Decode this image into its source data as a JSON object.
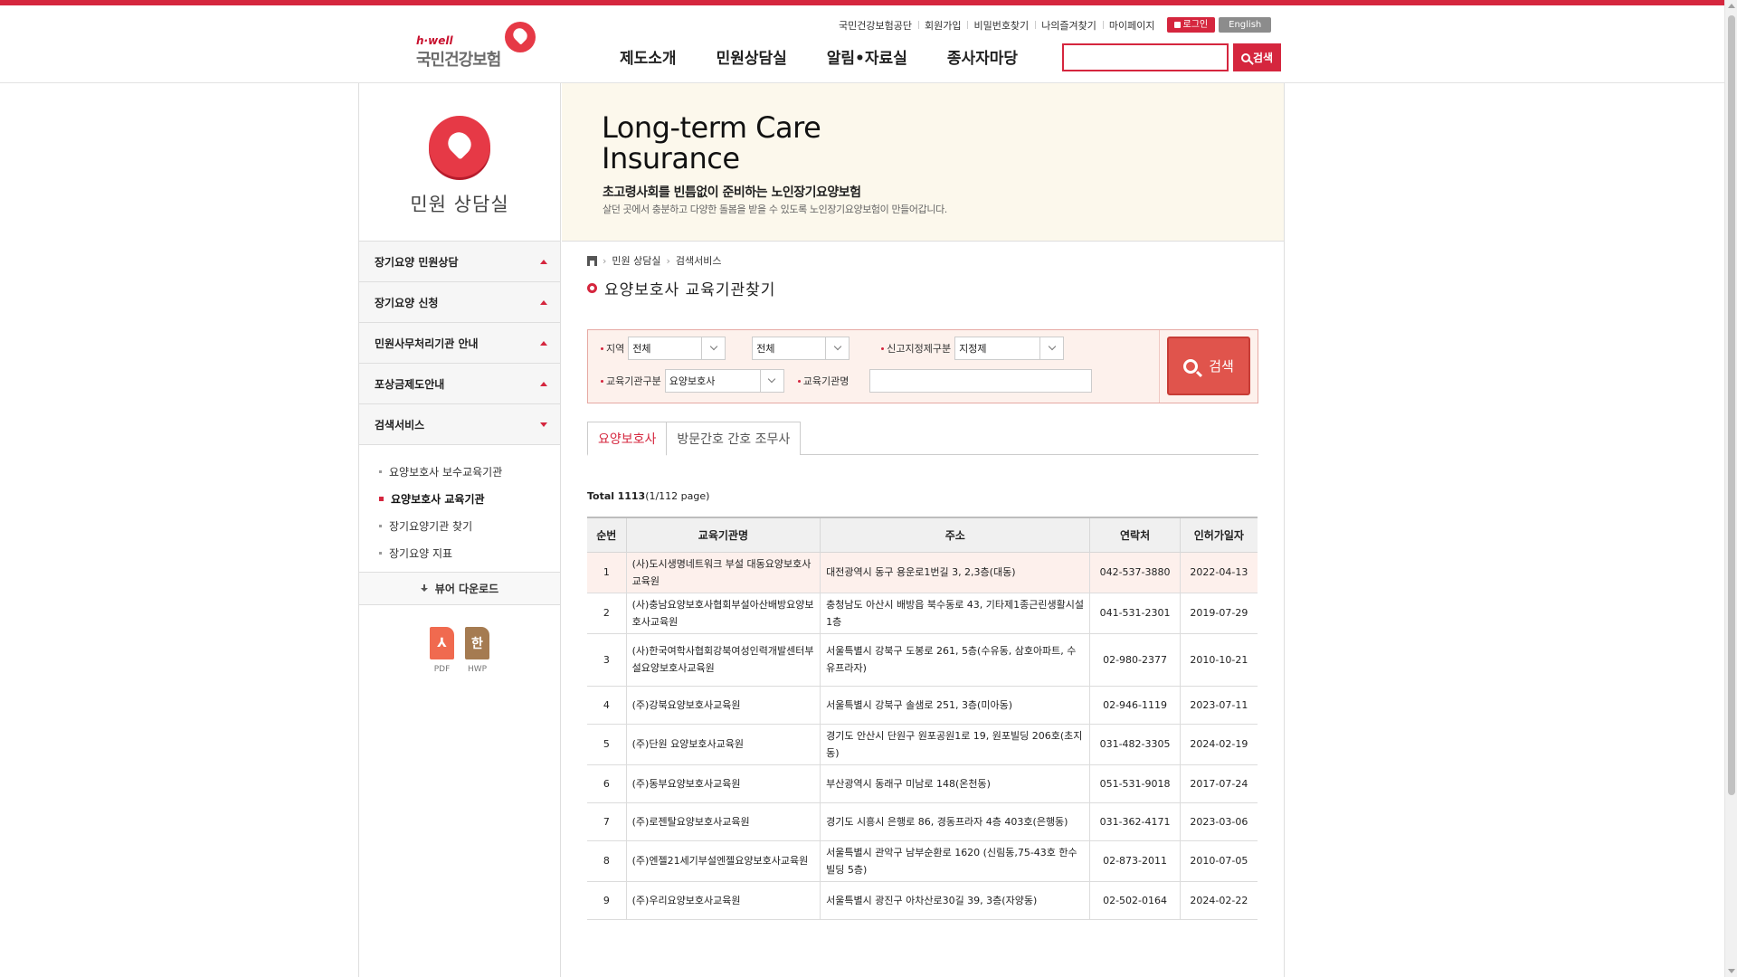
{
  "header": {
    "logo_tagline": "h·well",
    "logo_name": "국민건강보험",
    "util": [
      "국민건강보험공단",
      "회원가입",
      "비밀번호찾기",
      "나의즐겨찾기",
      "마이페이지"
    ],
    "login_label": "로그인",
    "english_label": "English",
    "gnb": [
      "제도소개",
      "민원상담실",
      "알림•자료실",
      "종사자마당"
    ],
    "search_value": "",
    "search_label": "검색"
  },
  "side": {
    "title": "민원 상담실",
    "menu": [
      {
        "label": "장기요양 민원상담"
      },
      {
        "label": "장기요양 신청"
      },
      {
        "label": "민원사무처리기관 안내"
      },
      {
        "label": "포상금제도안내"
      },
      {
        "label": "검색서비스"
      }
    ],
    "submenu": [
      "요양보호사 보수교육기관",
      "요양보호사 교육기관",
      "장기요양기관 찾기",
      "장기요양 지표"
    ],
    "viewer_label": "뷰어 다운로드",
    "files": [
      "PDF",
      "HWP"
    ],
    "hwp_glyph": "한"
  },
  "banner": {
    "en_line1": "Long-term Care",
    "en_line2": "Insurance",
    "ko_main": "초고령사회를 빈틈없이 준비하는 노인장기요양보험",
    "ko_sub": "살던 곳에서 충분하고 다양한 돌봄을 받을 수 있도록 노인장기요양보험이 만들어갑니다."
  },
  "content": {
    "breadcrumb": [
      "민원 상담실",
      "검색서비스"
    ],
    "page_title": "요양보호사 교육기관찾기",
    "filters": {
      "region_label": "지역",
      "region1": "전체",
      "region2": "전체",
      "type_label": "신고지정제구분",
      "type_value": "지정제",
      "category_label": "교육기관구분",
      "category_value": "요양보호사",
      "name_label": "교육기관명",
      "name_value": "",
      "search_label": "검색"
    },
    "tabs": [
      "요양보호사",
      "방문간호 간호 조무사"
    ],
    "total_label": "Total",
    "total_count": "1113",
    "total_page": "(1/112 page)",
    "columns": [
      "순번",
      "교육기관명",
      "주소",
      "연락처",
      "인허가일자"
    ],
    "rows": [
      [
        "1",
        "(사)도시생명네트워크 부설 대동요양보호사교육원",
        "대전광역시 동구 용운로1번길 3, 2,3층(대동)",
        "042-537-3880",
        "2022-04-13"
      ],
      [
        "2",
        "(사)충남요양보호사협회부설아산배방요양보호사교육원",
        "충청남도 아산시 배방읍 북수동로 43, 기타제1종근린생활시설 1층",
        "041-531-2301",
        "2019-07-29"
      ],
      [
        "3",
        "(사)한국여학사협회강북여성인력개발센터부설요양보호사교육원",
        "서울특별시 강북구 도봉로 261, 5층(수유동, 삼호아파트, 수유프라자)",
        "02-980-2377",
        "2010-10-21"
      ],
      [
        "4",
        "(주)강북요양보호사교육원",
        "서울특별시 강북구 솔샘로 251, 3층(미아동)",
        "02-946-1119",
        "2023-07-11"
      ],
      [
        "5",
        "(주)단원 요양보호사교육원",
        "경기도 안산시 단원구 원포공원1로 19, 원포빌딩 206호(초지동)",
        "031-482-3305",
        "2024-02-19"
      ],
      [
        "6",
        "(주)동부요양보호사교육원",
        "부산광역시 동래구 미남로 148(온천동)",
        "051-531-9018",
        "2017-07-24"
      ],
      [
        "7",
        "(주)로젠탈요양보호사교육원",
        "경기도 시흥시 은행로 86, 경동프라자 4층 403호(은행동)",
        "031-362-4171",
        "2023-03-06"
      ],
      [
        "8",
        "(주)엔젤21세기부설엔젤요양보호사교육원",
        "서울특별시 관악구 남부순환로 1620 (신림동,75-43호 한수빌딩 5층)",
        "02-873-2011",
        "2010-07-05"
      ],
      [
        "9",
        "(주)우리요양보호사교육원",
        "서울특별시 광진구 아차산로30길 39, 3층(자양동)",
        "02-502-0164",
        "2024-02-22"
      ]
    ]
  },
  "colors": {
    "accent": "#d5263e",
    "banner_bg": "#fcf8ec",
    "search_bg": "#fdf1ec"
  }
}
